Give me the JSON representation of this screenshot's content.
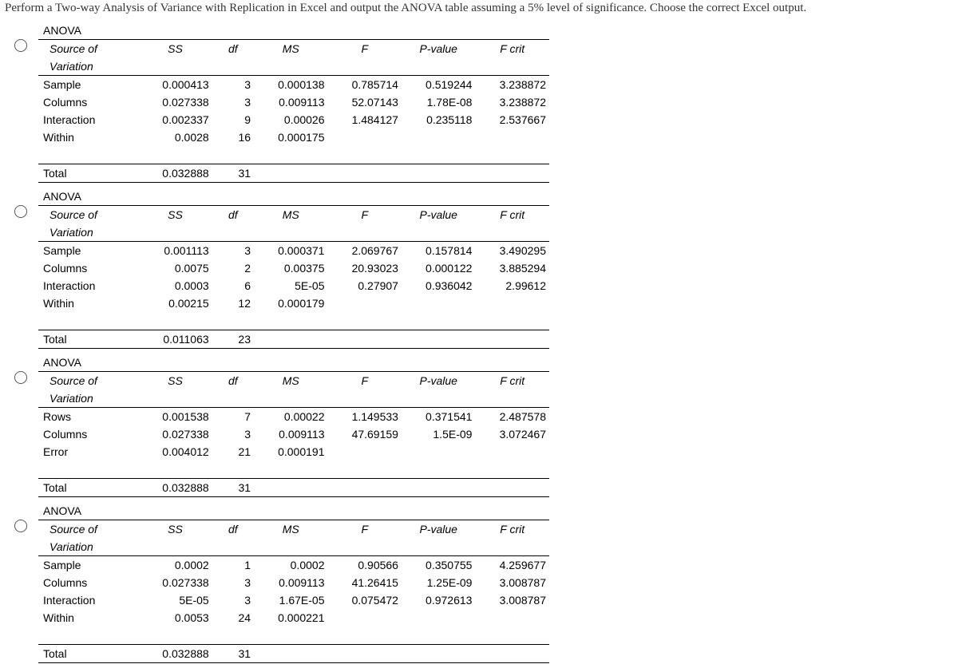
{
  "instruction": "Perform a Two-way Analysis of Variance with Replication in Excel and output the ANOVA table assuming a 5% level of significance. Choose the correct Excel output.",
  "labels": {
    "anova": "ANOVA",
    "source": "Source of",
    "variation": "Variation",
    "total": "Total"
  },
  "headers": [
    "SS",
    "df",
    "MS",
    "F",
    "P-value",
    "F crit"
  ],
  "tables": [
    {
      "rows": [
        {
          "name": "Sample",
          "ss": "0.000413",
          "df": "3",
          "ms": "0.000138",
          "f": "0.785714",
          "p": "0.519244",
          "fc": "3.238872"
        },
        {
          "name": "Columns",
          "ss": "0.027338",
          "df": "3",
          "ms": "0.009113",
          "f": "52.07143",
          "p": "1.78E-08",
          "fc": "3.238872"
        },
        {
          "name": "Interaction",
          "ss": "0.002337",
          "df": "9",
          "ms": "0.00026",
          "f": "1.484127",
          "p": "0.235118",
          "fc": "2.537667"
        },
        {
          "name": "Within",
          "ss": "0.0028",
          "df": "16",
          "ms": "0.000175",
          "f": "",
          "p": "",
          "fc": ""
        }
      ],
      "total": {
        "ss": "0.032888",
        "df": "31"
      }
    },
    {
      "rows": [
        {
          "name": "Sample",
          "ss": "0.001113",
          "df": "3",
          "ms": "0.000371",
          "f": "2.069767",
          "p": "0.157814",
          "fc": "3.490295"
        },
        {
          "name": "Columns",
          "ss": "0.0075",
          "df": "2",
          "ms": "0.00375",
          "f": "20.93023",
          "p": "0.000122",
          "fc": "3.885294"
        },
        {
          "name": "Interaction",
          "ss": "0.0003",
          "df": "6",
          "ms": "5E-05",
          "f": "0.27907",
          "p": "0.936042",
          "fc": "2.99612"
        },
        {
          "name": "Within",
          "ss": "0.00215",
          "df": "12",
          "ms": "0.000179",
          "f": "",
          "p": "",
          "fc": ""
        }
      ],
      "total": {
        "ss": "0.011063",
        "df": "23"
      }
    },
    {
      "rows": [
        {
          "name": "Rows",
          "ss": "0.001538",
          "df": "7",
          "ms": "0.00022",
          "f": "1.149533",
          "p": "0.371541",
          "fc": "2.487578"
        },
        {
          "name": "Columns",
          "ss": "0.027338",
          "df": "3",
          "ms": "0.009113",
          "f": "47.69159",
          "p": "1.5E-09",
          "fc": "3.072467"
        },
        {
          "name": "Error",
          "ss": "0.004012",
          "df": "21",
          "ms": "0.000191",
          "f": "",
          "p": "",
          "fc": ""
        }
      ],
      "total": {
        "ss": "0.032888",
        "df": "31"
      }
    },
    {
      "rows": [
        {
          "name": "Sample",
          "ss": "0.0002",
          "df": "1",
          "ms": "0.0002",
          "f": "0.90566",
          "p": "0.350755",
          "fc": "4.259677"
        },
        {
          "name": "Columns",
          "ss": "0.027338",
          "df": "3",
          "ms": "0.009113",
          "f": "41.26415",
          "p": "1.25E-09",
          "fc": "3.008787"
        },
        {
          "name": "Interaction",
          "ss": "5E-05",
          "df": "3",
          "ms": "1.67E-05",
          "f": "0.075472",
          "p": "0.972613",
          "fc": "3.008787"
        },
        {
          "name": "Within",
          "ss": "0.0053",
          "df": "24",
          "ms": "0.000221",
          "f": "",
          "p": "",
          "fc": ""
        }
      ],
      "total": {
        "ss": "0.032888",
        "df": "31"
      }
    }
  ]
}
